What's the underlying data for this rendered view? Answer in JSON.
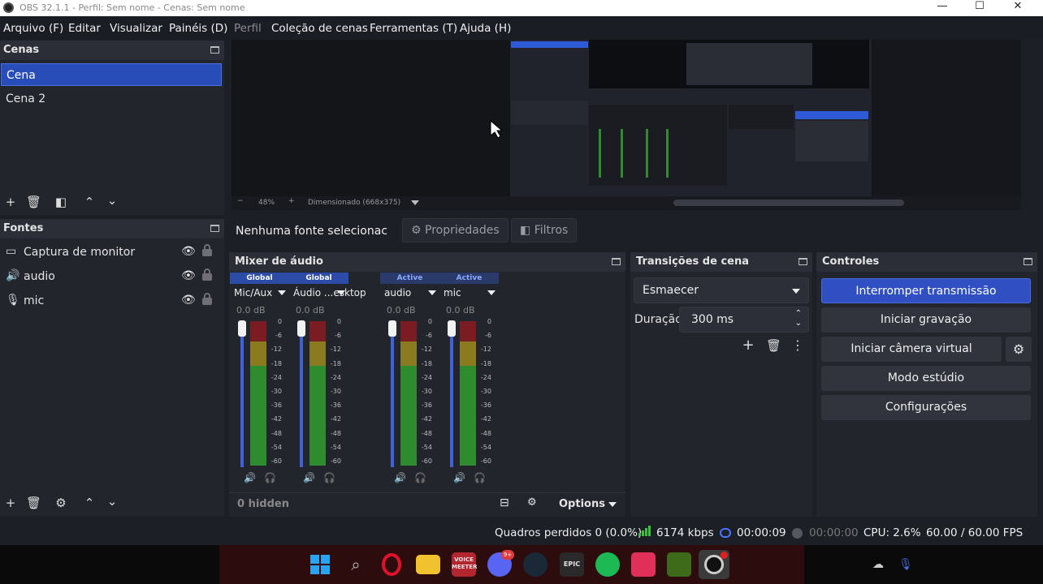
{
  "title_bar": {
    "title": "OBS 32.1.1 - Perfil: Sem nome - Cenas: Sem nome",
    "minimize": "—",
    "maximize": "☐",
    "close": "✕"
  },
  "menu": [
    {
      "label": "Arquivo (F)"
    },
    {
      "label": "Editar"
    },
    {
      "label": "Visualizar"
    },
    {
      "label": "Painéis (D)"
    },
    {
      "label": "Perfil"
    },
    {
      "label": "Coleção de cenas"
    },
    {
      "label": "Ferramentas (T)"
    },
    {
      "label": "Ajuda (H)"
    }
  ],
  "scenes": {
    "title": "Cenas",
    "items": [
      {
        "label": "Cena"
      },
      {
        "label": "Cena 2"
      }
    ]
  },
  "sources": {
    "title": "Fontes",
    "items": [
      {
        "label": "Captura de monitor",
        "icon": "monitor-icon"
      },
      {
        "label": "audio",
        "icon": "speaker-icon"
      },
      {
        "label": "mic",
        "icon": "microphone-icon"
      }
    ]
  },
  "preview": {
    "zoom": "48%",
    "scale_mode": "Dimensionado (668x375)"
  },
  "properties_bar": {
    "no_source": "Nenhuma fonte selecionac",
    "properties": "Propriedades",
    "filters": "Filtros"
  },
  "mixer": {
    "title": "Mixer de áudio",
    "hidden": "0 hidden",
    "options": "Options",
    "scale": [
      "0",
      "-6",
      "-12",
      "-18",
      "-24",
      "-30",
      "-36",
      "-42",
      "-48",
      "-54",
      "-60"
    ],
    "channels": [
      {
        "badge": "Global",
        "name": "Mic/Aux",
        "db": "0.0 dB",
        "level": 0.86
      },
      {
        "badge": "Global",
        "name": "Áudio ...esktop",
        "db": "0.0 dB",
        "level": 0.86
      },
      {
        "badge": "Active",
        "name": "audio",
        "db": "0.0 dB",
        "level": 0.86
      },
      {
        "badge": "Active",
        "name": "mic",
        "db": "0.0 dB",
        "level": 0.86
      }
    ]
  },
  "transitions": {
    "title": "Transições de cena",
    "selected": "Esmaecer",
    "duration_label": "Duração",
    "duration_value": "300 ms"
  },
  "controls": {
    "title": "Controles",
    "buttons": [
      {
        "label": "Interromper transmissão"
      },
      {
        "label": "Iniciar gravação"
      },
      {
        "label": "Iniciar câmera virtual"
      },
      {
        "label": "Modo estúdio"
      },
      {
        "label": "Configurações"
      }
    ]
  },
  "status": {
    "dropped": "Quadros perdidos 0 (0.0%)",
    "bitrate": "6174 kbps",
    "stream_time": "00:00:09",
    "rec_time": "00:00:00",
    "cpu": "CPU: 2.6%",
    "fps": "60.00 / 60.00 FPS"
  },
  "taskbar": {
    "voicemeeter": "VOICE\nMEETER",
    "discord_badge": "9+",
    "epic": "EPIC"
  },
  "colors": {
    "accent": "#284cb8",
    "meter_green": "#2e8b2e",
    "meter_yellow": "#8a7a20",
    "meter_red": "#7a1c22"
  }
}
